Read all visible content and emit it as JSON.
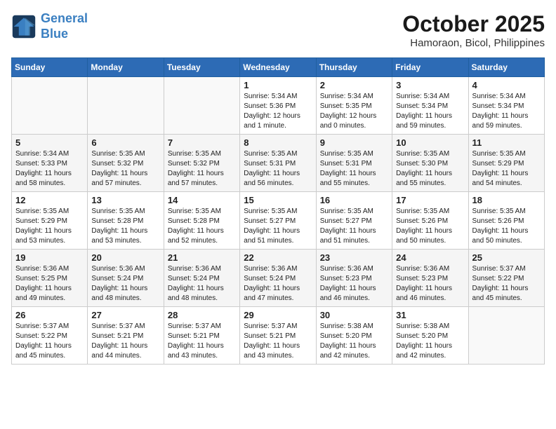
{
  "header": {
    "logo_line1": "General",
    "logo_line2": "Blue",
    "month": "October 2025",
    "location": "Hamoraon, Bicol, Philippines"
  },
  "weekdays": [
    "Sunday",
    "Monday",
    "Tuesday",
    "Wednesday",
    "Thursday",
    "Friday",
    "Saturday"
  ],
  "weeks": [
    [
      {
        "day": "",
        "info": ""
      },
      {
        "day": "",
        "info": ""
      },
      {
        "day": "",
        "info": ""
      },
      {
        "day": "1",
        "info": "Sunrise: 5:34 AM\nSunset: 5:36 PM\nDaylight: 12 hours\nand 1 minute."
      },
      {
        "day": "2",
        "info": "Sunrise: 5:34 AM\nSunset: 5:35 PM\nDaylight: 12 hours\nand 0 minutes."
      },
      {
        "day": "3",
        "info": "Sunrise: 5:34 AM\nSunset: 5:34 PM\nDaylight: 11 hours\nand 59 minutes."
      },
      {
        "day": "4",
        "info": "Sunrise: 5:34 AM\nSunset: 5:34 PM\nDaylight: 11 hours\nand 59 minutes."
      }
    ],
    [
      {
        "day": "5",
        "info": "Sunrise: 5:34 AM\nSunset: 5:33 PM\nDaylight: 11 hours\nand 58 minutes."
      },
      {
        "day": "6",
        "info": "Sunrise: 5:35 AM\nSunset: 5:32 PM\nDaylight: 11 hours\nand 57 minutes."
      },
      {
        "day": "7",
        "info": "Sunrise: 5:35 AM\nSunset: 5:32 PM\nDaylight: 11 hours\nand 57 minutes."
      },
      {
        "day": "8",
        "info": "Sunrise: 5:35 AM\nSunset: 5:31 PM\nDaylight: 11 hours\nand 56 minutes."
      },
      {
        "day": "9",
        "info": "Sunrise: 5:35 AM\nSunset: 5:31 PM\nDaylight: 11 hours\nand 55 minutes."
      },
      {
        "day": "10",
        "info": "Sunrise: 5:35 AM\nSunset: 5:30 PM\nDaylight: 11 hours\nand 55 minutes."
      },
      {
        "day": "11",
        "info": "Sunrise: 5:35 AM\nSunset: 5:29 PM\nDaylight: 11 hours\nand 54 minutes."
      }
    ],
    [
      {
        "day": "12",
        "info": "Sunrise: 5:35 AM\nSunset: 5:29 PM\nDaylight: 11 hours\nand 53 minutes."
      },
      {
        "day": "13",
        "info": "Sunrise: 5:35 AM\nSunset: 5:28 PM\nDaylight: 11 hours\nand 53 minutes."
      },
      {
        "day": "14",
        "info": "Sunrise: 5:35 AM\nSunset: 5:28 PM\nDaylight: 11 hours\nand 52 minutes."
      },
      {
        "day": "15",
        "info": "Sunrise: 5:35 AM\nSunset: 5:27 PM\nDaylight: 11 hours\nand 51 minutes."
      },
      {
        "day": "16",
        "info": "Sunrise: 5:35 AM\nSunset: 5:27 PM\nDaylight: 11 hours\nand 51 minutes."
      },
      {
        "day": "17",
        "info": "Sunrise: 5:35 AM\nSunset: 5:26 PM\nDaylight: 11 hours\nand 50 minutes."
      },
      {
        "day": "18",
        "info": "Sunrise: 5:35 AM\nSunset: 5:26 PM\nDaylight: 11 hours\nand 50 minutes."
      }
    ],
    [
      {
        "day": "19",
        "info": "Sunrise: 5:36 AM\nSunset: 5:25 PM\nDaylight: 11 hours\nand 49 minutes."
      },
      {
        "day": "20",
        "info": "Sunrise: 5:36 AM\nSunset: 5:24 PM\nDaylight: 11 hours\nand 48 minutes."
      },
      {
        "day": "21",
        "info": "Sunrise: 5:36 AM\nSunset: 5:24 PM\nDaylight: 11 hours\nand 48 minutes."
      },
      {
        "day": "22",
        "info": "Sunrise: 5:36 AM\nSunset: 5:24 PM\nDaylight: 11 hours\nand 47 minutes."
      },
      {
        "day": "23",
        "info": "Sunrise: 5:36 AM\nSunset: 5:23 PM\nDaylight: 11 hours\nand 46 minutes."
      },
      {
        "day": "24",
        "info": "Sunrise: 5:36 AM\nSunset: 5:23 PM\nDaylight: 11 hours\nand 46 minutes."
      },
      {
        "day": "25",
        "info": "Sunrise: 5:37 AM\nSunset: 5:22 PM\nDaylight: 11 hours\nand 45 minutes."
      }
    ],
    [
      {
        "day": "26",
        "info": "Sunrise: 5:37 AM\nSunset: 5:22 PM\nDaylight: 11 hours\nand 45 minutes."
      },
      {
        "day": "27",
        "info": "Sunrise: 5:37 AM\nSunset: 5:21 PM\nDaylight: 11 hours\nand 44 minutes."
      },
      {
        "day": "28",
        "info": "Sunrise: 5:37 AM\nSunset: 5:21 PM\nDaylight: 11 hours\nand 43 minutes."
      },
      {
        "day": "29",
        "info": "Sunrise: 5:37 AM\nSunset: 5:21 PM\nDaylight: 11 hours\nand 43 minutes."
      },
      {
        "day": "30",
        "info": "Sunrise: 5:38 AM\nSunset: 5:20 PM\nDaylight: 11 hours\nand 42 minutes."
      },
      {
        "day": "31",
        "info": "Sunrise: 5:38 AM\nSunset: 5:20 PM\nDaylight: 11 hours\nand 42 minutes."
      },
      {
        "day": "",
        "info": ""
      }
    ]
  ]
}
